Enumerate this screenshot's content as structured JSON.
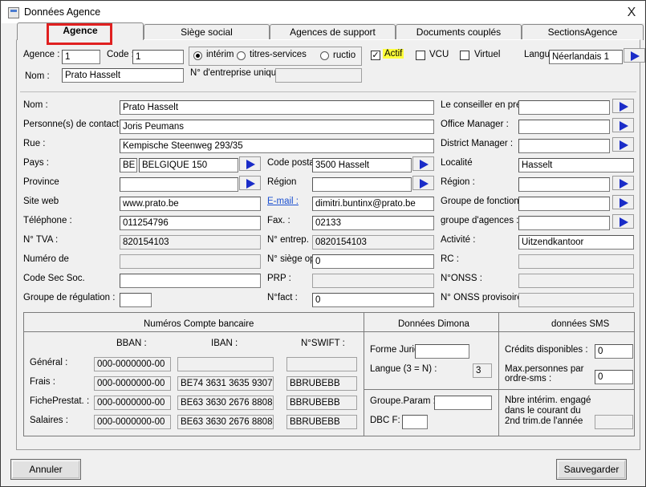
{
  "window": {
    "title": "Données Agence",
    "close": "X"
  },
  "tabs": [
    "Agence",
    "Siège social",
    "Agences de support",
    "Documents couplés",
    "SectionsAgence"
  ],
  "top": {
    "agence_label": "Agence :",
    "agence_value": "1",
    "code_label": "Code :",
    "code_value": "1",
    "radio": [
      {
        "label": "intérim",
        "checked": true
      },
      {
        "label": "titres-services",
        "checked": false
      },
      {
        "label": "ructio",
        "checked": false
      }
    ],
    "actif_label": "Actif",
    "actif_checked": true,
    "vcu_label": "VCU",
    "vcu_checked": false,
    "virtuel_label": "Virtuel",
    "virtuel_checked": false,
    "langue_label": "Langu",
    "langue_value": "Néerlandais 1",
    "nom_label": "Nom :",
    "nom_value": "Prato Hasselt",
    "entreprise_label": "N° d'entreprise unique",
    "entreprise_value": ""
  },
  "form": {
    "nom_label": "Nom :",
    "nom_value": "Prato Hasselt",
    "contact_label": "Personne(s) de contact",
    "contact_value": "Joris Peumans",
    "rue_label": "Rue :",
    "rue_value": "Kempische Steenweg 293/35",
    "pays_label": "Pays :",
    "pays_code": "BE",
    "pays_value": "BELGIQUE 150",
    "codepostal_label": "Code postal",
    "codepostal_value": "3500 Hasselt",
    "localite_label": "Localité",
    "localite_value": "Hasselt",
    "province_label": "Province",
    "province_value": "",
    "region_label": "Région",
    "region_value": "",
    "region2_label": "Région :",
    "region2_value": "",
    "site_label": "Site web",
    "site_value": "www.prato.be",
    "email_label": "E-mail :",
    "email_value": "dimitri.buntinx@prato.be",
    "groupe_fonctions_label": "Groupe de fonctions",
    "groupe_fonctions_value": "",
    "tel_label": "Téléphone :",
    "tel_value": "011254796",
    "fax_label": "Fax. :",
    "fax_value": "02133",
    "groupe_agences_label": "groupe d'agences :",
    "groupe_agences_value": "",
    "tva_label": "N° TVA :",
    "tva_value": "820154103",
    "entrep_label": "N° entrep. :",
    "entrep_value": "0820154103",
    "activite_label": "Activité :",
    "activite_value": "Uitzendkantoor",
    "numero_label": "Numéro de",
    "numero_value": "",
    "siege_label": "N° siège op",
    "siege_value": "0",
    "rc_label": "RC :",
    "rc_value": "",
    "codesec_label": "Code Sec Soc.",
    "codesec_value": "",
    "prp_label": "PRP :",
    "prp_value": "",
    "onss_label": "N°ONSS :",
    "onss_value": "",
    "regulation_label": "Groupe de régulation :",
    "regulation_value": "",
    "nfact_label": "N°fact :",
    "nfact_value": "0",
    "onss_prov_label": "N° ONSS provisoire",
    "onss_prov_value": "",
    "conseiller_label": "Le conseiller en prév",
    "conseiller_value": "",
    "office_label": "Office Manager :",
    "office_value": "",
    "district_label": "District Manager :",
    "district_value": ""
  },
  "bank": {
    "title": "Numéros Compte bancaire",
    "col_bban": "BBAN :",
    "col_iban": "IBAN :",
    "col_swift": "N°SWIFT :",
    "rows": [
      {
        "label": "Général :",
        "bban": "000-0000000-00",
        "iban": "",
        "swift": ""
      },
      {
        "label": "Frais :",
        "bban": "000-0000000-00",
        "iban": "BE74 3631 3635 9307",
        "swift": "BBRUBEBB"
      },
      {
        "label": "FichePrestat. :",
        "bban": "000-0000000-00",
        "iban": "BE63 3630 2676 8808",
        "swift": "BBRUBEBB"
      },
      {
        "label": "Salaires :",
        "bban": "000-0000000-00",
        "iban": "BE63 3630 2676 8808",
        "swift": "BBRUBEBB"
      }
    ]
  },
  "dimona": {
    "title": "Données Dimona",
    "forme_label": "Forme Juridi",
    "forme_value": "",
    "langue_label": "Langue (3 = N) :",
    "langue_value": "3",
    "groupe_label": "Groupe.Param :",
    "groupe_value": "",
    "dbc_label": "DBC F:",
    "dbc_value": ""
  },
  "sms": {
    "title": "données SMS",
    "credits_label": "Crédits disponibles :",
    "credits_value": "0",
    "max_label1": "Max.personnes par",
    "max_label2": "ordre-sms :",
    "max_value": "0",
    "nbre_label1": "Nbre intérim. engagé",
    "nbre_label2": "dans le courant du",
    "nbre_label3": "2nd trim.de l'année",
    "nbre_value": ""
  },
  "buttons": {
    "cancel": "Annuler",
    "save": "Sauvegarder"
  }
}
